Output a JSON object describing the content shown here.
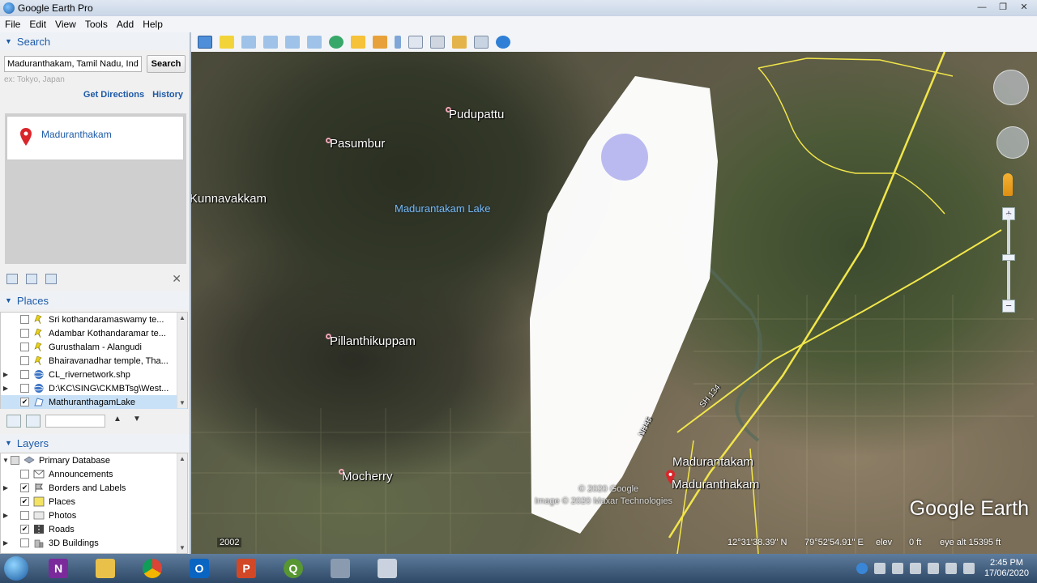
{
  "window": {
    "title": "Google Earth Pro"
  },
  "menu": [
    "File",
    "Edit",
    "View",
    "Tools",
    "Add",
    "Help"
  ],
  "search": {
    "header": "Search",
    "query": "Maduranthakam, Tamil Nadu, India",
    "button": "Search",
    "hint": "ex: Tokyo, Japan",
    "get_directions": "Get Directions",
    "history": "History",
    "result": "Maduranthakam"
  },
  "places": {
    "header": "Places",
    "items": [
      {
        "label": "Sri kothandaramaswamy te...",
        "icon": "yellow-pin-icon",
        "checked": false
      },
      {
        "label": "Adambar Kothandaramar te...",
        "icon": "yellow-pin-icon",
        "checked": false
      },
      {
        "label": "Gurusthalam - Alangudi",
        "icon": "yellow-pin-icon",
        "checked": false
      },
      {
        "label": "Bhairavanadhar temple, Tha...",
        "icon": "yellow-pin-icon",
        "checked": false
      },
      {
        "label": "CL_rivernetwork.shp",
        "icon": "network-link-icon",
        "checked": false
      },
      {
        "label": "D:\\KC\\SING\\CKMBTsg\\West...",
        "icon": "network-link-icon",
        "checked": false
      },
      {
        "label": "MathuranthagamLake",
        "icon": "polygon-icon",
        "checked": true
      }
    ]
  },
  "layers": {
    "header": "Layers",
    "items": [
      {
        "label": "Primary Database",
        "icon": "database-icon",
        "checked": false
      },
      {
        "label": "Announcements",
        "icon": "announcements-icon",
        "checked": false
      },
      {
        "label": "Borders and Labels",
        "icon": "borders-icon",
        "checked": true
      },
      {
        "label": "Places",
        "icon": "places-icon",
        "checked": true
      },
      {
        "label": "Photos",
        "icon": "photos-icon",
        "checked": false
      },
      {
        "label": "Roads",
        "icon": "roads-icon",
        "checked": true
      },
      {
        "label": "3D Buildings",
        "icon": "buildings-icon",
        "checked": false
      }
    ]
  },
  "map": {
    "labels": {
      "pudupattu": "Pudupattu",
      "pasumbur": "Pasumbur",
      "kunnavakkam": "Kunnavakkam",
      "lake": "Madurantakam Lake",
      "pillanthikuppam": "Pillanthikuppam",
      "mocherry": "Mocherry",
      "madurantakam": "Madurantakam",
      "maduranthakam": "Maduranthakam",
      "nh45": "NH45",
      "sh134": "SH 134"
    },
    "credit_google": "© 2020 Google",
    "credit_image": "Image © 2020 Maxar Technologies",
    "logo": "Google Earth",
    "year": "2002",
    "lat": "12°31'38.39\" N",
    "lon": "79°52'54.91\" E",
    "elev_label": "elev",
    "elev": "0 ft",
    "eye_alt": "eye alt  15395 ft"
  },
  "taskbar": {
    "time": "2:45 PM",
    "date": "17/06/2020"
  },
  "colors": {
    "accent": "#1e5aa8",
    "road": "#f2e64a",
    "polygon": "#ffffff",
    "marker": "#b3b3f0"
  }
}
